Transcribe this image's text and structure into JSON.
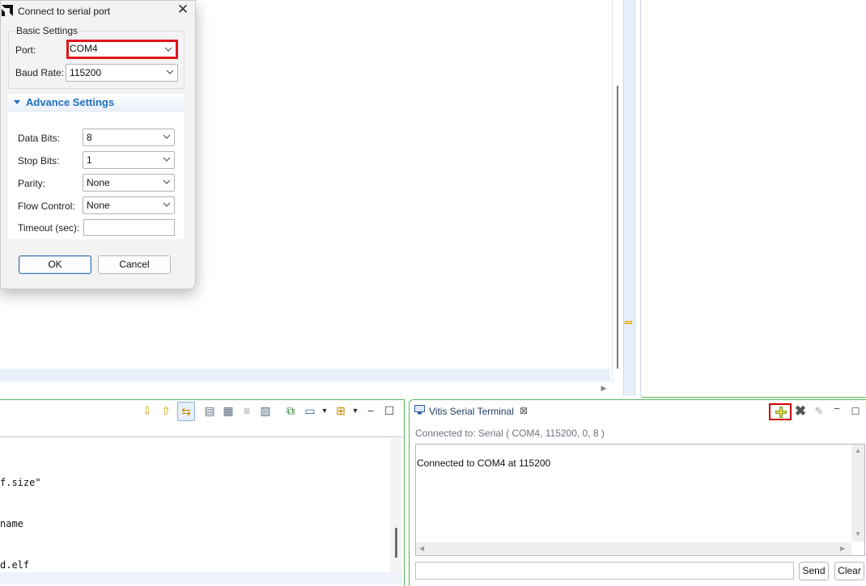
{
  "dialog": {
    "title": "Connect to serial port",
    "basic_group": "Basic Settings",
    "port_label": "Port:",
    "port_value": "COM4",
    "baud_label": "Baud Rate:",
    "baud_value": "115200",
    "advance_label": "Advance Settings",
    "data_bits_label": "Data Bits:",
    "data_bits_value": "8",
    "stop_bits_label": "Stop Bits:",
    "stop_bits_value": "1",
    "parity_label": "Parity:",
    "parity_value": "None",
    "flow_label": "Flow Control:",
    "flow_value": "None",
    "timeout_label": "Timeout (sec):",
    "timeout_value": "",
    "ok_label": "OK",
    "cancel_label": "Cancel"
  },
  "console": {
    "lines": [
      "f.size\"",
      "name",
      "d.elf"
    ]
  },
  "terminal": {
    "tab_label": "Vitis Serial Terminal",
    "tab_close": "⊠",
    "status": "Connected to: Serial (  COM4, 115200, 0, 8 )",
    "output": "Connected to COM4 at 115200",
    "input_value": "",
    "send_label": "Send",
    "clear_label": "Clear"
  },
  "colors": {
    "highlight": "#e0141b",
    "accent_blue": "#1f6fc2",
    "panel_border_green": "#58b85e"
  },
  "icons": {
    "toolbar": [
      "arrow-down-icon",
      "arrow-up-icon",
      "link-icon",
      "pin-icon",
      "lock-icon",
      "word-wrap-icon",
      "clear-console-icon",
      "open-console-icon",
      "display-console-icon",
      "new-console-icon",
      "minimize-icon",
      "maximize-icon"
    ],
    "terminal": [
      "add-connection-icon",
      "disconnect-icon",
      "clear-terminal-icon",
      "minimize-icon",
      "maximize-icon"
    ]
  }
}
